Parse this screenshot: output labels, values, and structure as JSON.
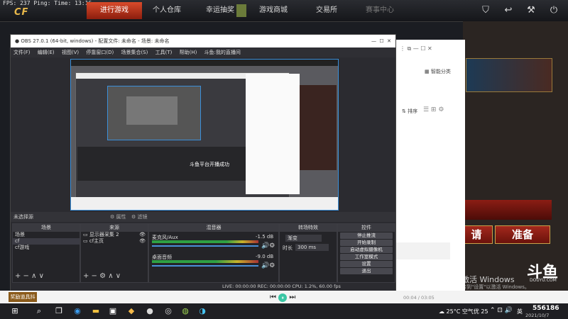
{
  "game": {
    "fps_text": "FPS: 237   Ping:      Time: 13:16",
    "logo_text": "CF",
    "tabs": [
      "进行游戏",
      "个人仓库",
      "幸运抽奖",
      "游戏商城",
      "交易所",
      "赛事中心"
    ],
    "right_buttons": {
      "ready_partial": "请",
      "ready": "准备"
    },
    "bottom_left_label": "奖励道具抖"
  },
  "browser": {
    "smart_category": "智能分类",
    "sort_label": "排序"
  },
  "obs": {
    "title": "OBS 27.0.1 (64-bit, windows) - 配置文件: 未命名 - 场景: 未命名",
    "menu": [
      "文件(F)",
      "编辑(E)",
      "视图(V)",
      "停靠窗口(D)",
      "场景集合(S)",
      "工具(T)",
      "帮助(H)",
      "斗鱼:我的直播间"
    ],
    "no_source_label": "未选择源",
    "props_label": "属性",
    "filters_label": "滤镜",
    "docks": {
      "scenes": "场景",
      "sources": "来源",
      "mixer": "混音器",
      "transitions": "转场特效",
      "controls": "控件"
    },
    "scenes": [
      "场景",
      "cf",
      "cf游戏"
    ],
    "sources": [
      "显示器采集 2",
      "cf主页"
    ],
    "mixer": [
      {
        "name": "麦克风/Aux",
        "db": "-1.5 dB"
      },
      {
        "name": "桌面音频",
        "db": "-9.0 dB"
      }
    ],
    "transition": {
      "type": "渐变",
      "duration_label": "时长",
      "duration": "300 ms"
    },
    "controls": [
      "停止推流",
      "开始录制",
      "启动虚拟摄像机",
      "工作室模式",
      "设置",
      "退出"
    ],
    "status": "LIVE: 00:00:00   REC: 00:00:00   CPU: 1.2%, 60.00 fps",
    "nested_text": "斗鱼平台开播成功"
  },
  "windows_watermark": {
    "line1": "激活 Windows",
    "line2": "转到\"设置\"以激活 Windows。"
  },
  "player": {
    "time": "00:04 / 03:05"
  },
  "taskbar": {
    "weather": "25°C 空气优 25",
    "ime": "英",
    "date": "2021/10/7",
    "room": "556186"
  },
  "douyu": {
    "logo": "斗鱼",
    "sub": "DOUYU.COM"
  }
}
